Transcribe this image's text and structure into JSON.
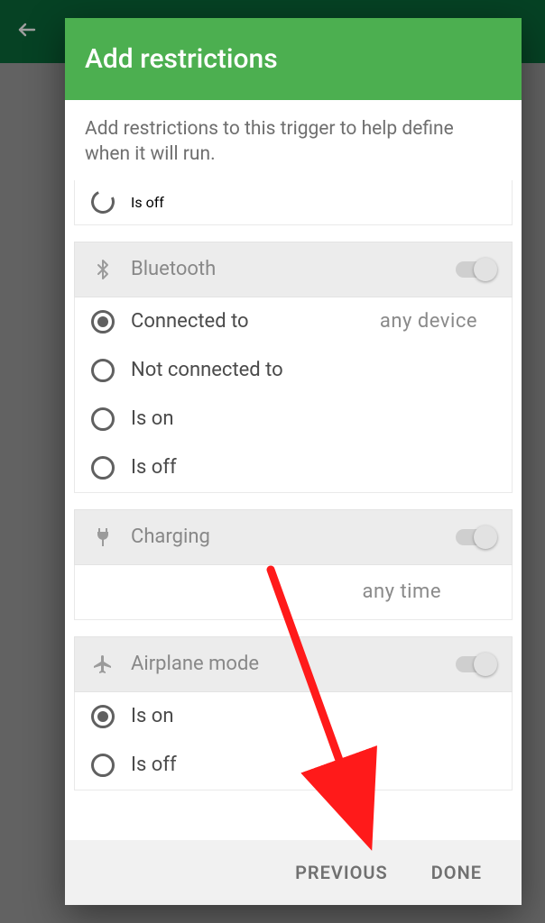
{
  "dialog": {
    "title": "Add restrictions",
    "subtitle": "Add restrictions to this trigger to help define when it will run."
  },
  "partial": {
    "label": "Is off"
  },
  "bluetooth": {
    "header": "Bluetooth",
    "options": {
      "connected": "Connected to",
      "not_connected": "Not connected to",
      "on": "Is on",
      "off": "Is off"
    },
    "value_text": "any device"
  },
  "charging": {
    "header": "Charging",
    "value_text": "any time"
  },
  "airplane": {
    "header": "Airplane mode",
    "options": {
      "on": "Is on",
      "off": "Is off"
    }
  },
  "buttons": {
    "previous": "PREVIOUS",
    "done": "DONE"
  }
}
